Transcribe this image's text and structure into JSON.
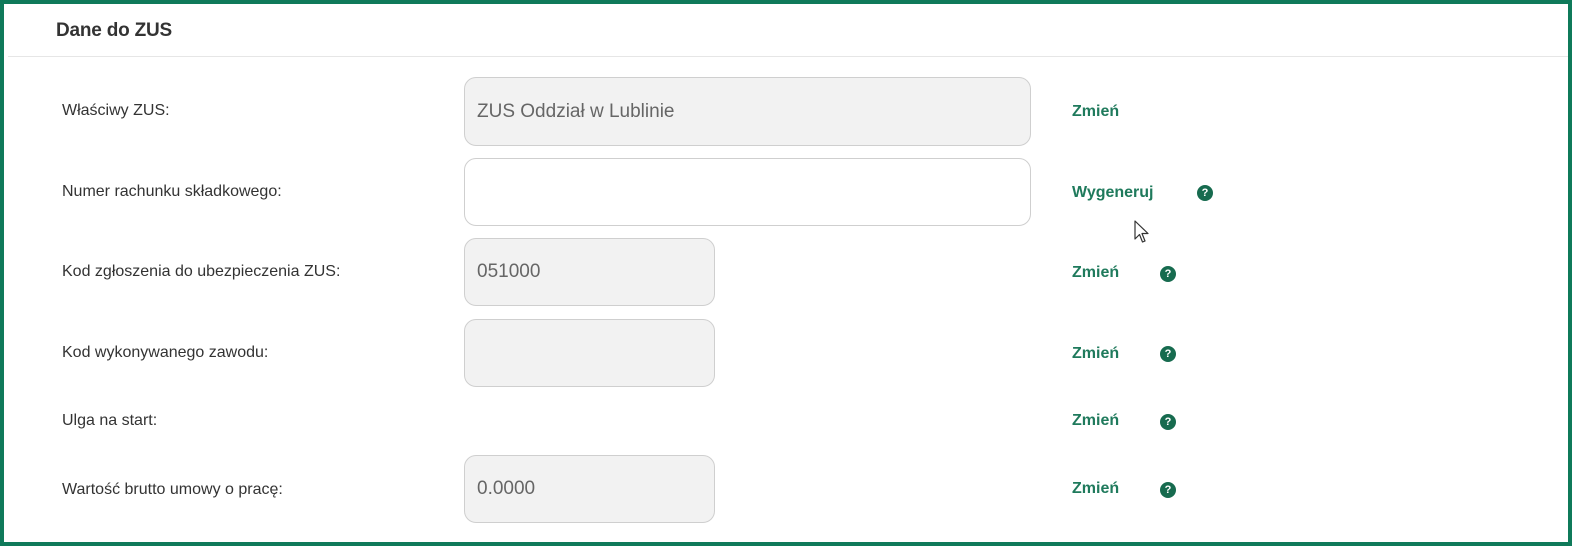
{
  "section": {
    "title": "Dane do ZUS"
  },
  "rows": [
    {
      "label": "Właściwy ZUS:",
      "value": "ZUS Oddział w Lublinie",
      "action": "Zmień",
      "help": false
    },
    {
      "label": "Numer rachunku składkowego:",
      "value": "",
      "action": "Wygeneruj",
      "help": true
    },
    {
      "label": "Kod zgłoszenia do ubezpieczenia ZUS:",
      "value": "051000",
      "action": "Zmień",
      "help": true
    },
    {
      "label": "Kod wykonywanego zawodu:",
      "value": "",
      "action": "Zmień",
      "help": true
    },
    {
      "label": "Ulga na start:",
      "action": "Zmień",
      "help": true
    },
    {
      "label": "Wartość brutto umowy o pracę:",
      "value": "0.0000",
      "action": "Zmień",
      "help": true
    }
  ],
  "icons": {
    "help": "question-mark-icon",
    "help_glyph": "?",
    "cursor": "mouse-pointer-icon"
  },
  "colors": {
    "border": "#0f7a5a",
    "link": "#1f7a5c",
    "help_icon": "#176b4f",
    "field_readonly_bg": "#f2f2f2",
    "field_editable_bg": "#ffffff"
  }
}
